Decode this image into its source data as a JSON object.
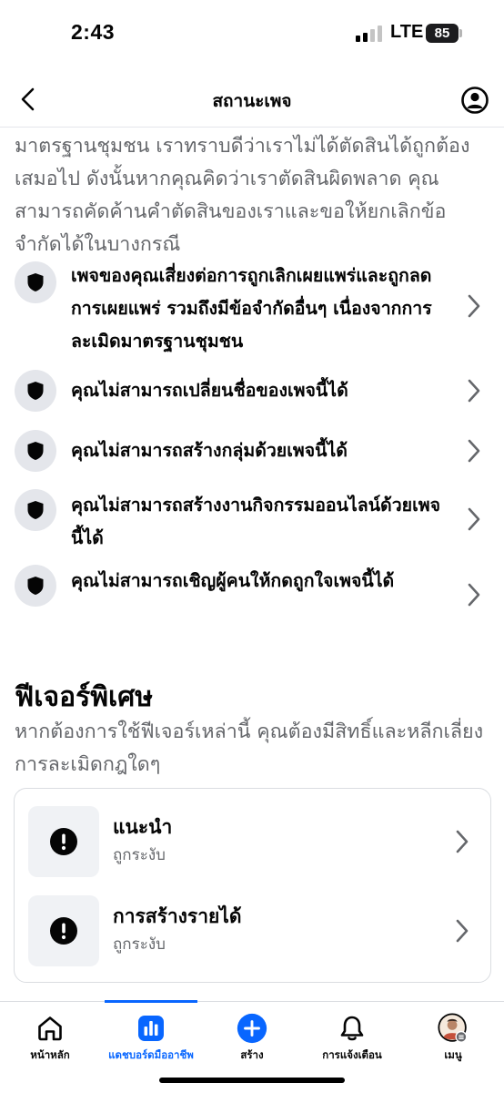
{
  "status_bar": {
    "time": "2:43",
    "network": "LTE",
    "battery": "85"
  },
  "header": {
    "title": "สถานะเพจ",
    "back_icon": "chevron-left-icon",
    "profile_icon": "user-circle-icon"
  },
  "intro_text": "มาตรฐานชุมชน เราทราบดีว่าเราไม่ได้ตัดสินได้ถูกต้องเสมอไป ดังนั้นหากคุณคิดว่าเราตัดสินผิดพลาด คุณสามารถคัดค้านคำตัดสินของเราและขอให้ยกเลิกข้อจำกัดได้ในบางกรณี",
  "restrictions": [
    {
      "icon": "shield-icon",
      "text": "เพจของคุณเสี่ยงต่อการถูกเลิกเผยแพร่และถูกลดการเผยแพร่ รวมถึงมีข้อจำกัดอื่นๆ เนื่องจากการละเมิดมาตรฐานชุมชน"
    },
    {
      "icon": "shield-icon",
      "text": "คุณไม่สามารถเปลี่ยนชื่อของเพจนี้ได้"
    },
    {
      "icon": "shield-icon",
      "text": "คุณไม่สามารถสร้างกลุ่มด้วยเพจนี้ได้"
    },
    {
      "icon": "shield-icon",
      "text": "คุณไม่สามารถสร้างงานกิจกรรมออนไลน์ด้วยเพจนี้ได้"
    },
    {
      "icon": "shield-icon",
      "text": "คุณไม่สามารถเชิญผู้คนให้กดถูกใจเพจนี้ได้"
    }
  ],
  "special_features": {
    "title": "ฟีเจอร์พิเศษ",
    "subtitle": "หากต้องการใช้ฟีเจอร์เหล่านี้ คุณต้องมีสิทธิ์และหลีกเลี่ยงการละเมิดกฎใดๆ",
    "items": [
      {
        "icon": "exclamation-icon",
        "title": "แนะนำ",
        "status": "ถูกระงับ"
      },
      {
        "icon": "exclamation-icon",
        "title": "การสร้างรายได้",
        "status": "ถูกระงับ"
      }
    ]
  },
  "bottom_nav": {
    "accent_color": "#0866ff",
    "items": [
      {
        "icon": "home-icon",
        "label": "หน้าหลัก",
        "active": false
      },
      {
        "icon": "dashboard-icon",
        "label": "แดชบอร์ดมืออาชีพ",
        "active": true
      },
      {
        "icon": "plus-circle-icon",
        "label": "สร้าง",
        "active": false
      },
      {
        "icon": "bell-icon",
        "label": "การแจ้งเตือน",
        "active": false
      },
      {
        "icon": "avatar-icon",
        "label": "เมนู",
        "active": false
      }
    ]
  }
}
